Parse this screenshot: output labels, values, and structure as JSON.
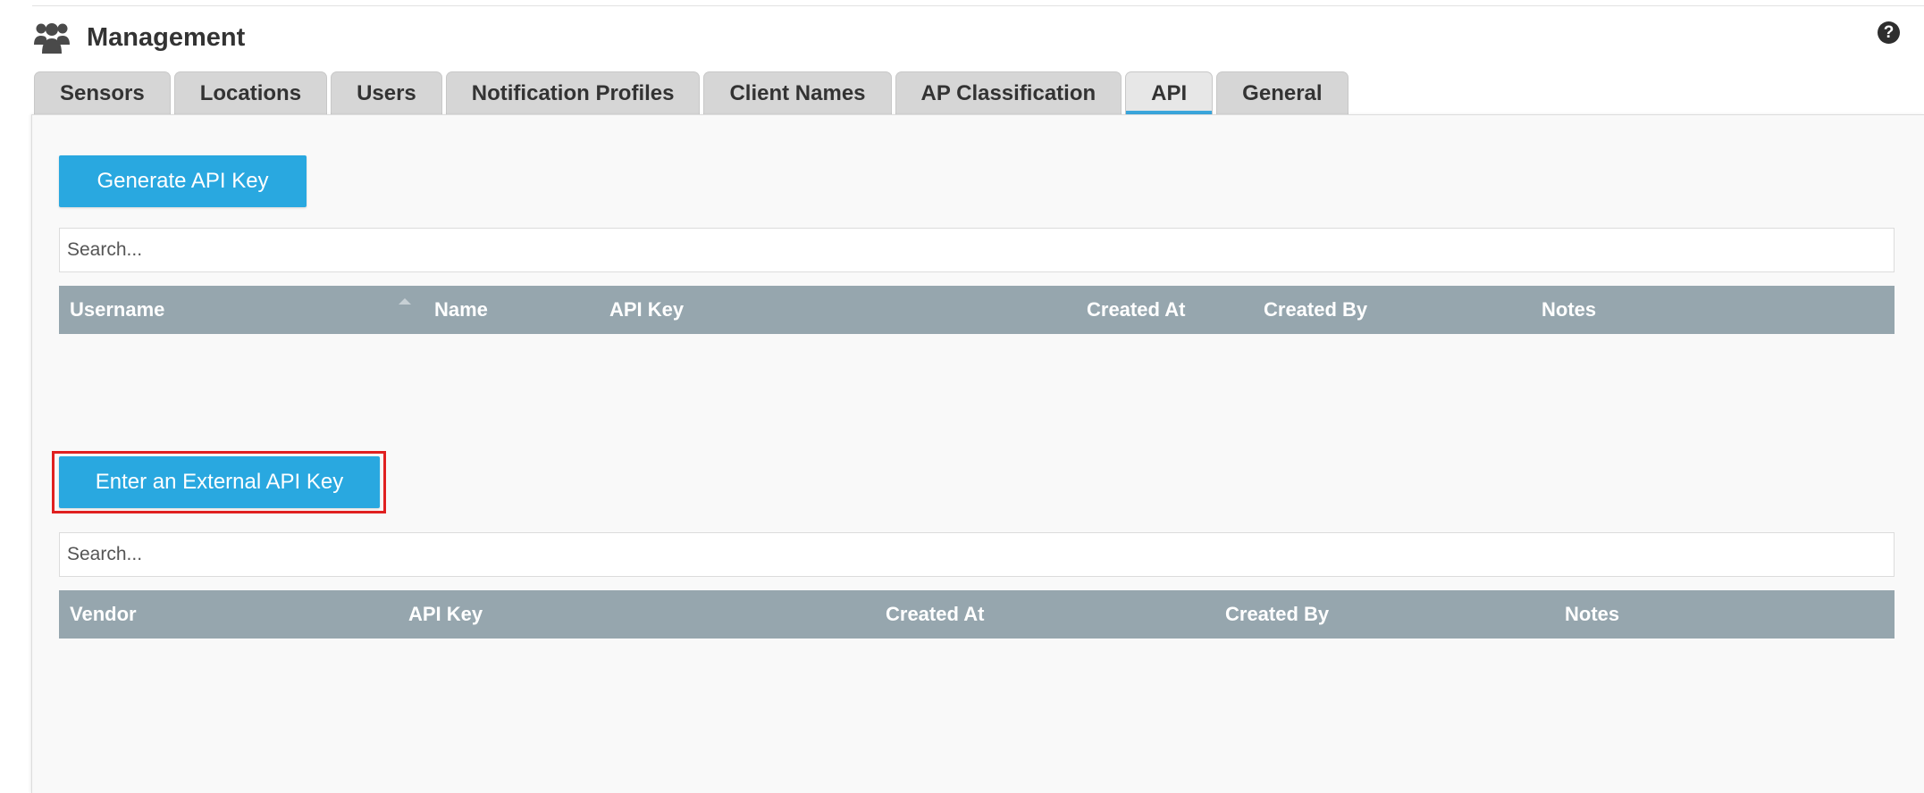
{
  "header": {
    "title": "Management",
    "icon": "users-group-icon",
    "help_icon": "question-circle-icon",
    "help_symbol": "?"
  },
  "tabs": [
    {
      "label": "Sensors",
      "active": false
    },
    {
      "label": "Locations",
      "active": false
    },
    {
      "label": "Users",
      "active": false
    },
    {
      "label": "Notification Profiles",
      "active": false
    },
    {
      "label": "Client Names",
      "active": false
    },
    {
      "label": "AP Classification",
      "active": false
    },
    {
      "label": "API",
      "active": true
    },
    {
      "label": "General",
      "active": false
    }
  ],
  "api_keys": {
    "generate_button": "Generate API Key",
    "search_placeholder": "Search...",
    "sort_icon": "sort-ascending-icon",
    "columns": [
      "Username",
      "Name",
      "API Key",
      "Created At",
      "Created By",
      "Notes"
    ],
    "rows": []
  },
  "external_keys": {
    "enter_button": "Enter an External API Key",
    "search_placeholder": "Search...",
    "columns": [
      "Vendor",
      "API Key",
      "Created At",
      "Created By",
      "Notes"
    ],
    "rows": []
  },
  "colors": {
    "accent": "#29a8e0",
    "table_header": "#96a6ae",
    "highlight": "#e02020",
    "active_tab_indicator": "#3ba7dc"
  }
}
